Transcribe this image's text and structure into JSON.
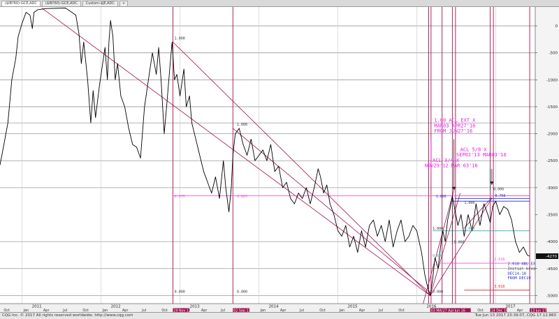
{
  "tabs": [
    "($IB?60)-GCE,ADC",
    "($IB?60)-GCE,ADC",
    "Custom-$JE,ADC",
    "+"
  ],
  "status": {
    "left": "CQG Inc. © 2017 All rights reserved worldwide. http://www.cqg.com",
    "right": "Tue Jun 13 2017 23:39:07, CQG 17.12.860"
  },
  "colors": {
    "price": "#000000",
    "grid": "#999999",
    "vline": "#a0104f",
    "magenta": "#e61ee6",
    "blue": "#1a2fd0",
    "pink": "#e85ad8",
    "teal": "#33aaaa",
    "red": "#e02020"
  },
  "chart_data": {
    "type": "line",
    "y_range": [
      -5150,
      350
    ],
    "y_ticks": [
      {
        "v": 0,
        "label": "0"
      },
      {
        "v": -500,
        "label": "-500"
      },
      {
        "v": -1000,
        "label": "-1000"
      },
      {
        "v": -1500,
        "label": "-1500"
      },
      {
        "v": -2000,
        "label": "-2000"
      },
      {
        "v": -2500,
        "label": "-2500"
      },
      {
        "v": -3000,
        "label": "-3000"
      },
      {
        "v": -3500,
        "label": "-3500"
      },
      {
        "v": -4000,
        "label": "-4000"
      },
      {
        "v": -4500,
        "label": "-4500"
      },
      {
        "v": -5000,
        "label": "-5000"
      }
    ],
    "last_value": {
      "v": -4270,
      "label": "-4270"
    },
    "x_range": [
      2010.72,
      2017.5
    ],
    "years": [
      {
        "t": 2011.0,
        "label": "2011"
      },
      {
        "t": 2012.0,
        "label": "2012"
      },
      {
        "t": 2013.0,
        "label": "2013"
      },
      {
        "t": 2014.0,
        "label": "2014"
      },
      {
        "t": 2015.0,
        "label": "2015"
      },
      {
        "t": 2016.0,
        "label": "2016"
      },
      {
        "t": 2017.0,
        "label": "2017"
      }
    ],
    "months": [
      {
        "t": 2010.75,
        "label": "Oct"
      },
      {
        "t": 2011.0,
        "label": "Jan"
      },
      {
        "t": 2011.25,
        "label": "Apr"
      },
      {
        "t": 2011.5,
        "label": "Jul"
      },
      {
        "t": 2011.75,
        "label": "Oct"
      },
      {
        "t": 2012.0,
        "label": "Jan"
      },
      {
        "t": 2012.25,
        "label": "Apr"
      },
      {
        "t": 2012.5,
        "label": "Jul"
      },
      {
        "t": 2012.75,
        "label": "Oct"
      },
      {
        "t": 2013.25,
        "label": "Apr"
      },
      {
        "t": 2013.5,
        "label": "Jul"
      },
      {
        "t": 2014.0,
        "label": "Jan"
      },
      {
        "t": 2014.25,
        "label": "Apr"
      },
      {
        "t": 2014.5,
        "label": "Jul"
      },
      {
        "t": 2014.75,
        "label": "Oct"
      },
      {
        "t": 2015.0,
        "label": "Jan"
      },
      {
        "t": 2015.25,
        "label": "Apr"
      },
      {
        "t": 2015.5,
        "label": "Jul"
      },
      {
        "t": 2015.75,
        "label": "Oct"
      },
      {
        "t": 2016.5,
        "label": "Jul"
      },
      {
        "t": 2016.75,
        "label": "Oct"
      },
      {
        "t": 2017.25,
        "label": "Apr"
      }
    ],
    "date_markers": [
      {
        "t": 2012.91,
        "label": "29 Nov 12"
      },
      {
        "t": 2013.67,
        "label": "02 Sep 13"
      },
      {
        "t": 2016.17,
        "label": "03 MAR"
      },
      {
        "t": 2016.32,
        "label": "27 Apr27"
      },
      {
        "t": 2016.47,
        "label": "Jun 16"
      },
      {
        "t": 2016.93,
        "label": "14 Dec 16"
      },
      {
        "t": 2017.43,
        "label": "13 Jun 17"
      }
    ],
    "vlines": [
      2012.91,
      2013.67,
      2016.15,
      2016.18,
      2016.32,
      2016.45,
      2016.49,
      2016.93,
      2016.97,
      2017.43
    ],
    "hlines": [
      -5000,
      -4500,
      -4000,
      -3000,
      -2500,
      -2000,
      -1800,
      -1500,
      -1000,
      -500,
      0
    ],
    "price": [
      [
        2010.72,
        -2580
      ],
      [
        2010.77,
        -2200
      ],
      [
        2010.82,
        -1800
      ],
      [
        2010.87,
        -1000
      ],
      [
        2010.92,
        -600
      ],
      [
        2010.95,
        -200
      ],
      [
        2011.0,
        50
      ],
      [
        2011.05,
        250
      ],
      [
        2011.1,
        200
      ],
      [
        2011.13,
        -50
      ],
      [
        2011.15,
        250
      ],
      [
        2011.2,
        300
      ],
      [
        2011.3,
        320
      ],
      [
        2011.55,
        330
      ],
      [
        2011.68,
        200
      ],
      [
        2011.72,
        -150
      ],
      [
        2011.75,
        -700
      ],
      [
        2011.78,
        -300
      ],
      [
        2011.83,
        -1000
      ],
      [
        2011.87,
        -1800
      ],
      [
        2011.9,
        -1200
      ],
      [
        2011.93,
        -1700
      ],
      [
        2011.98,
        -1100
      ],
      [
        2012.02,
        -700
      ],
      [
        2012.05,
        -400
      ],
      [
        2012.08,
        -1000
      ],
      [
        2012.1,
        -300
      ],
      [
        2012.12,
        100
      ],
      [
        2012.15,
        -200
      ],
      [
        2012.18,
        -1000
      ],
      [
        2012.21,
        -700
      ],
      [
        2012.25,
        -1300
      ],
      [
        2012.3,
        -1500
      ],
      [
        2012.35,
        -1900
      ],
      [
        2012.4,
        -2200
      ],
      [
        2012.45,
        -2250
      ],
      [
        2012.5,
        -2450
      ],
      [
        2012.55,
        -1500
      ],
      [
        2012.6,
        -1000
      ],
      [
        2012.65,
        -500
      ],
      [
        2012.7,
        -900
      ],
      [
        2012.73,
        -400
      ],
      [
        2012.76,
        -1000
      ],
      [
        2012.8,
        -2000
      ],
      [
        2012.83,
        -1500
      ],
      [
        2012.87,
        -800
      ],
      [
        2012.9,
        -300
      ],
      [
        2012.93,
        -1000
      ],
      [
        2012.96,
        -900
      ],
      [
        2013.0,
        -1300
      ],
      [
        2013.05,
        -800
      ],
      [
        2013.08,
        -1500
      ],
      [
        2013.12,
        -1300
      ],
      [
        2013.15,
        -1800
      ],
      [
        2013.2,
        -2100
      ],
      [
        2013.25,
        -2400
      ],
      [
        2013.3,
        -2700
      ],
      [
        2013.35,
        -2900
      ],
      [
        2013.4,
        -3100
      ],
      [
        2013.45,
        -2800
      ],
      [
        2013.5,
        -3200
      ],
      [
        2013.55,
        -2500
      ],
      [
        2013.58,
        -3000
      ],
      [
        2013.62,
        -3450
      ],
      [
        2013.65,
        -3000
      ],
      [
        2013.67,
        -2400
      ],
      [
        2013.7,
        -2000
      ],
      [
        2013.75,
        -1900
      ],
      [
        2013.8,
        -2200
      ],
      [
        2013.85,
        -2400
      ],
      [
        2013.9,
        -2100
      ],
      [
        2013.95,
        -2500
      ],
      [
        2014.0,
        -2400
      ],
      [
        2014.05,
        -2300
      ],
      [
        2014.1,
        -2500
      ],
      [
        2014.15,
        -2200
      ],
      [
        2014.2,
        -2700
      ],
      [
        2014.25,
        -2600
      ],
      [
        2014.3,
        -3000
      ],
      [
        2014.35,
        -2900
      ],
      [
        2014.4,
        -3200
      ],
      [
        2014.45,
        -3300
      ],
      [
        2014.5,
        -3100
      ],
      [
        2014.55,
        -3200
      ],
      [
        2014.6,
        -3000
      ],
      [
        2014.65,
        -3300
      ],
      [
        2014.7,
        -3000
      ],
      [
        2014.75,
        -2650
      ],
      [
        2014.78,
        -2800
      ],
      [
        2014.82,
        -3100
      ],
      [
        2014.86,
        -2950
      ],
      [
        2014.9,
        -3300
      ],
      [
        2014.95,
        -3500
      ],
      [
        2015.0,
        -3800
      ],
      [
        2015.05,
        -3900
      ],
      [
        2015.1,
        -3700
      ],
      [
        2015.15,
        -4100
      ],
      [
        2015.2,
        -3900
      ],
      [
        2015.25,
        -4200
      ],
      [
        2015.3,
        -3800
      ],
      [
        2015.35,
        -4100
      ],
      [
        2015.4,
        -3700
      ],
      [
        2015.45,
        -3600
      ],
      [
        2015.5,
        -3900
      ],
      [
        2015.55,
        -3700
      ],
      [
        2015.6,
        -4000
      ],
      [
        2015.65,
        -3600
      ],
      [
        2015.7,
        -4100
      ],
      [
        2015.75,
        -3800
      ],
      [
        2015.8,
        -3600
      ],
      [
        2015.85,
        -4000
      ],
      [
        2015.9,
        -3900
      ],
      [
        2015.95,
        -3700
      ],
      [
        2016.0,
        -3800
      ],
      [
        2016.03,
        -4000
      ],
      [
        2016.06,
        -4200
      ],
      [
        2016.1,
        -4600
      ],
      [
        2016.13,
        -4800
      ],
      [
        2016.17,
        -5000
      ],
      [
        2016.2,
        -4700
      ],
      [
        2016.23,
        -4300
      ],
      [
        2016.27,
        -4500
      ],
      [
        2016.3,
        -4100
      ],
      [
        2016.33,
        -3800
      ],
      [
        2016.36,
        -4000
      ],
      [
        2016.39,
        -3600
      ],
      [
        2016.42,
        -3400
      ],
      [
        2016.45,
        -3150
      ],
      [
        2016.48,
        -3400
      ],
      [
        2016.52,
        -3700
      ],
      [
        2016.56,
        -3500
      ],
      [
        2016.6,
        -3900
      ],
      [
        2016.65,
        -3500
      ],
      [
        2016.7,
        -3800
      ],
      [
        2016.75,
        -3300
      ],
      [
        2016.8,
        -3700
      ],
      [
        2016.85,
        -3300
      ],
      [
        2016.9,
        -3500
      ],
      [
        2016.93,
        -3650
      ],
      [
        2016.96,
        -3350
      ],
      [
        2017.0,
        -3250
      ],
      [
        2017.05,
        -3500
      ],
      [
        2017.1,
        -3350
      ],
      [
        2017.15,
        -3400
      ],
      [
        2017.2,
        -3600
      ],
      [
        2017.25,
        -4000
      ],
      [
        2017.3,
        -4200
      ],
      [
        2017.35,
        -4100
      ],
      [
        2017.4,
        -4250
      ],
      [
        2017.43,
        -4270
      ]
    ],
    "trendlines": [
      {
        "from": [
          2011.25,
          330
        ],
        "to": [
          2016.17,
          -5000
        ],
        "color": "#a0104f"
      },
      {
        "from": [
          2012.91,
          -300
        ],
        "to": [
          2016.17,
          -5000
        ],
        "color": "#a0104f"
      },
      {
        "from": [
          2013.67,
          -1900
        ],
        "to": [
          2016.17,
          -4950
        ],
        "color": "#a0104f"
      },
      {
        "from": [
          2016.08,
          -5150
        ],
        "to": [
          2016.47,
          -3050
        ],
        "color": "#a0104f"
      },
      {
        "from": [
          2016.17,
          -5000
        ],
        "to": [
          2016.55,
          -3100
        ],
        "color": "#a0104f"
      },
      {
        "from": [
          2016.17,
          -5000
        ],
        "to": [
          2016.95,
          -3200
        ],
        "color": "#a0104f"
      },
      {
        "from": [
          2016.6,
          -3750
        ],
        "to": [
          2016.95,
          -3180
        ],
        "color": "#a0104f"
      },
      {
        "from": [
          2016.45,
          -3150
        ],
        "to": [
          2017.43,
          -3150
        ],
        "color": "#1a2fd0"
      },
      {
        "from": [
          2016.48,
          -3200
        ],
        "to": [
          2017.43,
          -3200
        ],
        "color": "#1a2fd0"
      },
      {
        "from": [
          2016.45,
          -3250
        ],
        "to": [
          2017.43,
          -3250
        ],
        "color": "#1a2fd0"
      },
      {
        "from": [
          2016.2,
          -3800
        ],
        "to": [
          2017.43,
          -3800
        ],
        "color": "#33aaaa"
      },
      {
        "from": [
          2016.2,
          -3150
        ],
        "to": [
          2017.43,
          -3150
        ],
        "color": "#e85ad8"
      },
      {
        "from": [
          2012.91,
          -3150
        ],
        "to": [
          2016.95,
          -3150
        ],
        "color": "#e85ad8"
      },
      {
        "from": [
          2016.3,
          -4400
        ],
        "to": [
          2017.43,
          -4400
        ],
        "color": "#e85ad8"
      },
      {
        "from": [
          2016.6,
          -4900
        ],
        "to": [
          2017.43,
          -4900
        ],
        "color": "#e02020"
      },
      {
        "from": [
          2016.45,
          -3150
        ],
        "to": [
          2016.45,
          -4050
        ],
        "color": "#333333"
      },
      {
        "from": [
          2016.93,
          -2650
        ],
        "to": [
          2016.93,
          -3050
        ],
        "color": "#333333"
      },
      {
        "from": [
          2016.18,
          -2100
        ],
        "to": [
          2016.18,
          -2700
        ],
        "color": "#e61ee6"
      }
    ],
    "annotations": [
      {
        "t": 2016.22,
        "v": -1780,
        "text": "1.00 ACL EXT X",
        "color": "#e61ee6",
        "size": 7
      },
      {
        "t": 2016.22,
        "v": -1880,
        "text": "MAR03 APR27'16",
        "color": "#e61ee6",
        "size": 7
      },
      {
        "t": 2016.22,
        "v": -1980,
        "text": "FROM JUN27'16",
        "color": "#e61ee6",
        "size": 7
      },
      {
        "t": 2016.55,
        "v": -2320,
        "text": "ACL 5/8 X",
        "color": "#e61ee6",
        "size": 7
      },
      {
        "t": 2016.5,
        "v": -2420,
        "text": "SEP02'13 MAR03'16",
        "color": "#e61ee6",
        "size": 7
      },
      {
        "t": 2016.2,
        "v": -2520,
        "text": "ACL 3/4 X",
        "color": "#e61ee6",
        "size": 7
      },
      {
        "t": 2016.1,
        "v": -2620,
        "text": "NOV29'12 MAR 03'16",
        "color": "#e61ee6",
        "size": 7
      },
      {
        "t": 2012.93,
        "v": -250,
        "text": "1.000",
        "color": "#333333",
        "size": 5
      },
      {
        "t": 2013.72,
        "v": -1850,
        "text": "1.000",
        "color": "#333333",
        "size": 5
      },
      {
        "t": 2012.93,
        "v": -3180,
        "text": "0.375",
        "color": "#e85ad8",
        "size": 5
      },
      {
        "t": 2013.72,
        "v": -3180,
        "text": "0.625",
        "color": "#e85ad8",
        "size": 5
      },
      {
        "t": 2012.93,
        "v": -4950,
        "text": "0.000",
        "color": "#333333",
        "size": 5
      },
      {
        "t": 2013.72,
        "v": -4950,
        "text": "0.000",
        "color": "#333333",
        "size": 5
      },
      {
        "t": 2016.2,
        "v": -4950,
        "text": "0.000",
        "color": "#333333",
        "size": 5
      },
      {
        "t": 2016.24,
        "v": -3180,
        "text": "1.000",
        "color": "#1a2fd0",
        "size": 5
      },
      {
        "t": 2016.97,
        "v": -3050,
        "text": "0.000",
        "color": "#333333",
        "size": 5
      },
      {
        "t": 2016.99,
        "v": -3170,
        "text": "0.750",
        "color": "#1a2fd0",
        "size": 5
      },
      {
        "t": 2016.6,
        "v": -3300,
        "text": "1.000",
        "color": "#333333",
        "size": 5
      },
      {
        "t": 2016.2,
        "v": -3780,
        "text": "1.000",
        "color": "#333333",
        "size": 5
      },
      {
        "t": 2016.6,
        "v": -3780,
        "text": "0.000",
        "color": "#33aaaa",
        "size": 5
      },
      {
        "t": 2016.47,
        "v": -4030,
        "text": "0.000",
        "color": "#333333",
        "size": 5
      },
      {
        "t": 2016.2,
        "v": -4280,
        "text": "0.800",
        "color": "#33aaaa",
        "size": 5
      },
      {
        "t": 2016.98,
        "v": -4350,
        "text": "2.618",
        "color": "#e85ad8",
        "size": 5
      },
      {
        "t": 2016.98,
        "v": -4850,
        "text": "3.618",
        "color": "#e02020",
        "size": 5
      },
      {
        "t": 2017.15,
        "v": -4430,
        "text": "2.618 ABL EX",
        "color": "#1a2fd0",
        "size": 5.5
      },
      {
        "t": 2017.15,
        "v": -4520,
        "text": "Initial brea",
        "color": "#333333",
        "size": 5.5
      },
      {
        "t": 2017.15,
        "v": -4610,
        "text": "DEC14-18",
        "color": "#1a2fd0",
        "size": 5.5
      },
      {
        "t": 2017.15,
        "v": -4700,
        "text": "FROM DEC19",
        "color": "#1a2fd0",
        "size": 5.5
      }
    ],
    "arrows": [
      {
        "t": 2016.47,
        "v1": -2100,
        "v2": -3050
      },
      {
        "t": 2016.95,
        "v1": -2650,
        "v2": -2950
      }
    ]
  }
}
